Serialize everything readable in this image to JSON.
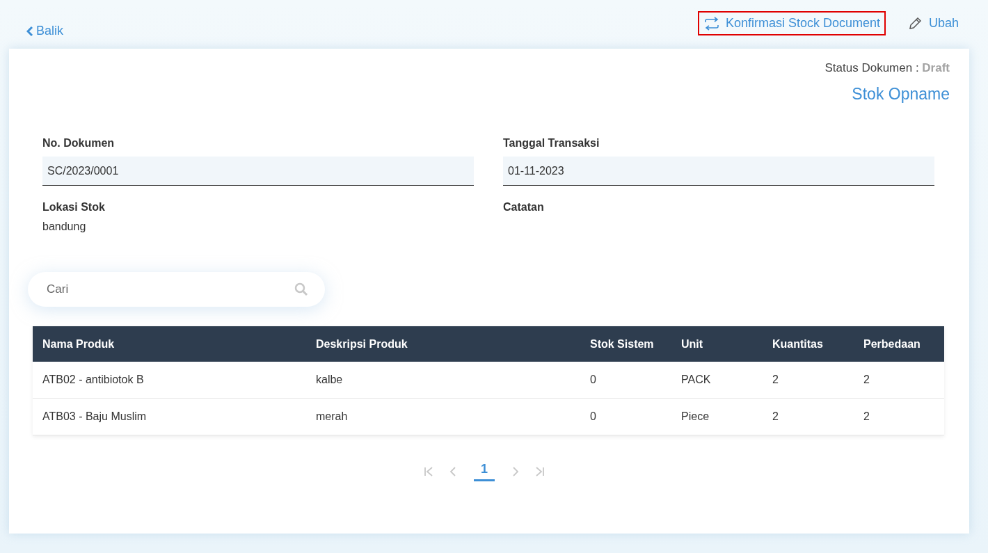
{
  "back_link": {
    "label": "Balik"
  },
  "actions": [
    {
      "kind": "confirm",
      "label": "Konfirmasi Stock Document",
      "highlighted": true
    },
    {
      "kind": "edit",
      "label": "Ubah",
      "highlighted": false
    }
  ],
  "status": {
    "label": "Status Dokumen :",
    "value": "Draft"
  },
  "document_type": "Stok Opname",
  "fields": [
    {
      "kind": "input",
      "label": "No. Dokumen",
      "value": "SC/2023/0001"
    },
    {
      "kind": "input",
      "label": "Tanggal Transaksi",
      "value": "01-11-2023"
    },
    {
      "kind": "text",
      "label": "Lokasi Stok",
      "value": "bandung"
    },
    {
      "kind": "text",
      "label": "Catatan"
    }
  ],
  "search": {
    "placeholder": "Cari"
  },
  "table": {
    "columns": [
      "Nama Produk",
      "Deskripsi Produk",
      "Stok Sistem",
      "Unit",
      "Kuantitas",
      "Perbedaan"
    ],
    "rows": [
      [
        "ATB02 - antibiotok B",
        "kalbe",
        "0",
        "PACK",
        "2",
        "2"
      ],
      [
        "ATB03 - Baju Muslim",
        "merah",
        "0",
        "Piece",
        "2",
        "2"
      ]
    ]
  },
  "pagination": {
    "first_disabled": true,
    "prev_disabled": true,
    "next_disabled": true,
    "last_disabled": true,
    "pages": [
      {
        "label": "1",
        "selected": true
      }
    ]
  }
}
